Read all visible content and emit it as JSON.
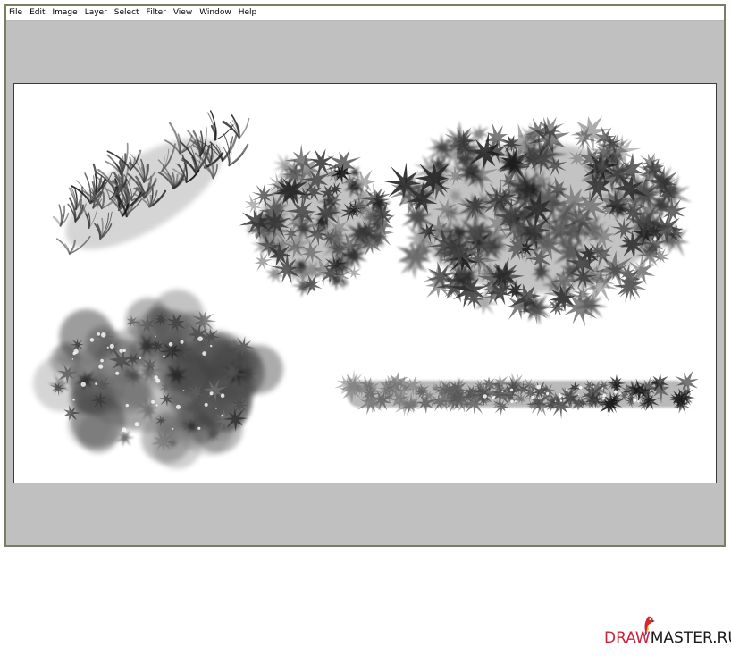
{
  "menu": {
    "items": [
      "File",
      "Edit",
      "Image",
      "Layer",
      "Select",
      "Filter",
      "View",
      "Window",
      "Help"
    ]
  },
  "canvas": {
    "strokes": [
      {
        "name": "grass-brush-stroke",
        "style": "grass"
      },
      {
        "name": "leaf-brush-stroke-small",
        "style": "leaf"
      },
      {
        "name": "leaf-brush-stroke-large",
        "style": "leaf"
      },
      {
        "name": "sponge-brush-stroke",
        "style": "cloud"
      },
      {
        "name": "leaf-brush-horizontal-stroke",
        "style": "line"
      }
    ]
  },
  "logo": {
    "part1": "DRAW",
    "part2": "MASTER.RU",
    "icon": "parrot-icon"
  },
  "colors": {
    "window_border": "#7a7d62",
    "workspace": "#c0c0c0",
    "canvas": "#ffffff",
    "ink": "#1e1e1e",
    "logo_accent": "#c8243c"
  }
}
